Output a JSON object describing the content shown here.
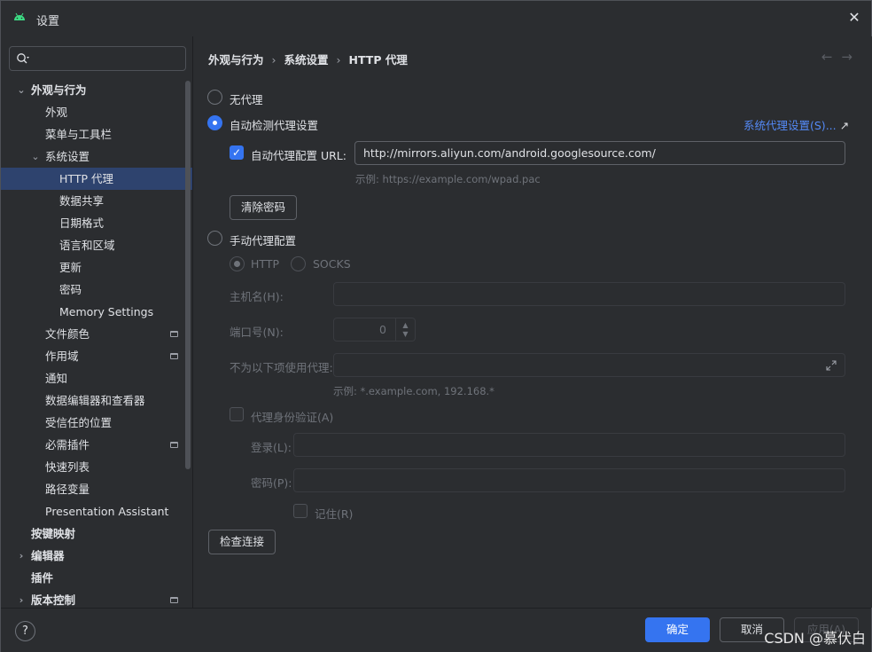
{
  "window": {
    "title": "设置"
  },
  "sidebar": {
    "search_placeholder": "",
    "items": [
      {
        "label": "外观与行为",
        "level": 0,
        "chevron": "down",
        "bold": true
      },
      {
        "label": "外观",
        "level": 1
      },
      {
        "label": "菜单与工具栏",
        "level": 1
      },
      {
        "label": "系统设置",
        "level": 1,
        "chevron": "down"
      },
      {
        "label": "HTTP 代理",
        "level": 2,
        "selected": true
      },
      {
        "label": "数据共享",
        "level": 2
      },
      {
        "label": "日期格式",
        "level": 2
      },
      {
        "label": "语言和区域",
        "level": 2
      },
      {
        "label": "更新",
        "level": 2
      },
      {
        "label": "密码",
        "level": 2
      },
      {
        "label": "Memory Settings",
        "level": 2
      },
      {
        "label": "文件颜色",
        "level": 1,
        "pin": true
      },
      {
        "label": "作用域",
        "level": 1,
        "pin": true
      },
      {
        "label": "通知",
        "level": 1
      },
      {
        "label": "数据编辑器和查看器",
        "level": 1
      },
      {
        "label": "受信任的位置",
        "level": 1
      },
      {
        "label": "必需插件",
        "level": 1,
        "pin": true
      },
      {
        "label": "快速列表",
        "level": 1
      },
      {
        "label": "路径变量",
        "level": 1
      },
      {
        "label": "Presentation Assistant",
        "level": 1
      },
      {
        "label": "按键映射",
        "level": 0,
        "bold": true
      },
      {
        "label": "编辑器",
        "level": 0,
        "chevron": "right",
        "bold": true
      },
      {
        "label": "插件",
        "level": 0,
        "bold": true
      },
      {
        "label": "版本控制",
        "level": 0,
        "chevron": "right",
        "bold": true,
        "pin": true
      }
    ]
  },
  "breadcrumb": [
    "外观与行为",
    "系统设置",
    "HTTP 代理"
  ],
  "proxy": {
    "no_proxy_label": "无代理",
    "auto_detect_label": "自动检测代理设置",
    "system_proxy_link": "系统代理设置(S)...",
    "auto_config_url_label": "自动代理配置 URL:",
    "auto_config_url_value": "http://mirrors.aliyun.com/android.googlesource.com/",
    "auto_config_example": "示例: https://example.com/wpad.pac",
    "clear_password_button": "清除密码",
    "manual_label": "手动代理配置",
    "http_label": "HTTP",
    "socks_label": "SOCKS",
    "host_label": "主机名(H):",
    "host_value": "",
    "port_label": "端口号(N):",
    "port_value": "0",
    "no_proxy_for_label": "不为以下项使用代理:",
    "no_proxy_for_value": "",
    "no_proxy_example": "示例: *.example.com, 192.168.*",
    "proxy_auth_label": "代理身份验证(A)",
    "login_label": "登录(L):",
    "login_value": "",
    "password_label": "密码(P):",
    "password_value": "",
    "remember_label": "记住(R)",
    "check_connection_button": "检查连接"
  },
  "footer": {
    "help": "?",
    "ok_button": "确定",
    "cancel_button": "取消",
    "apply_button": "应用(A)",
    "watermark": "CSDN @慕伏白"
  },
  "colors": {
    "accent": "#3574f0",
    "selection": "#2e436e",
    "link": "#548af7",
    "background": "#2b2d30"
  }
}
